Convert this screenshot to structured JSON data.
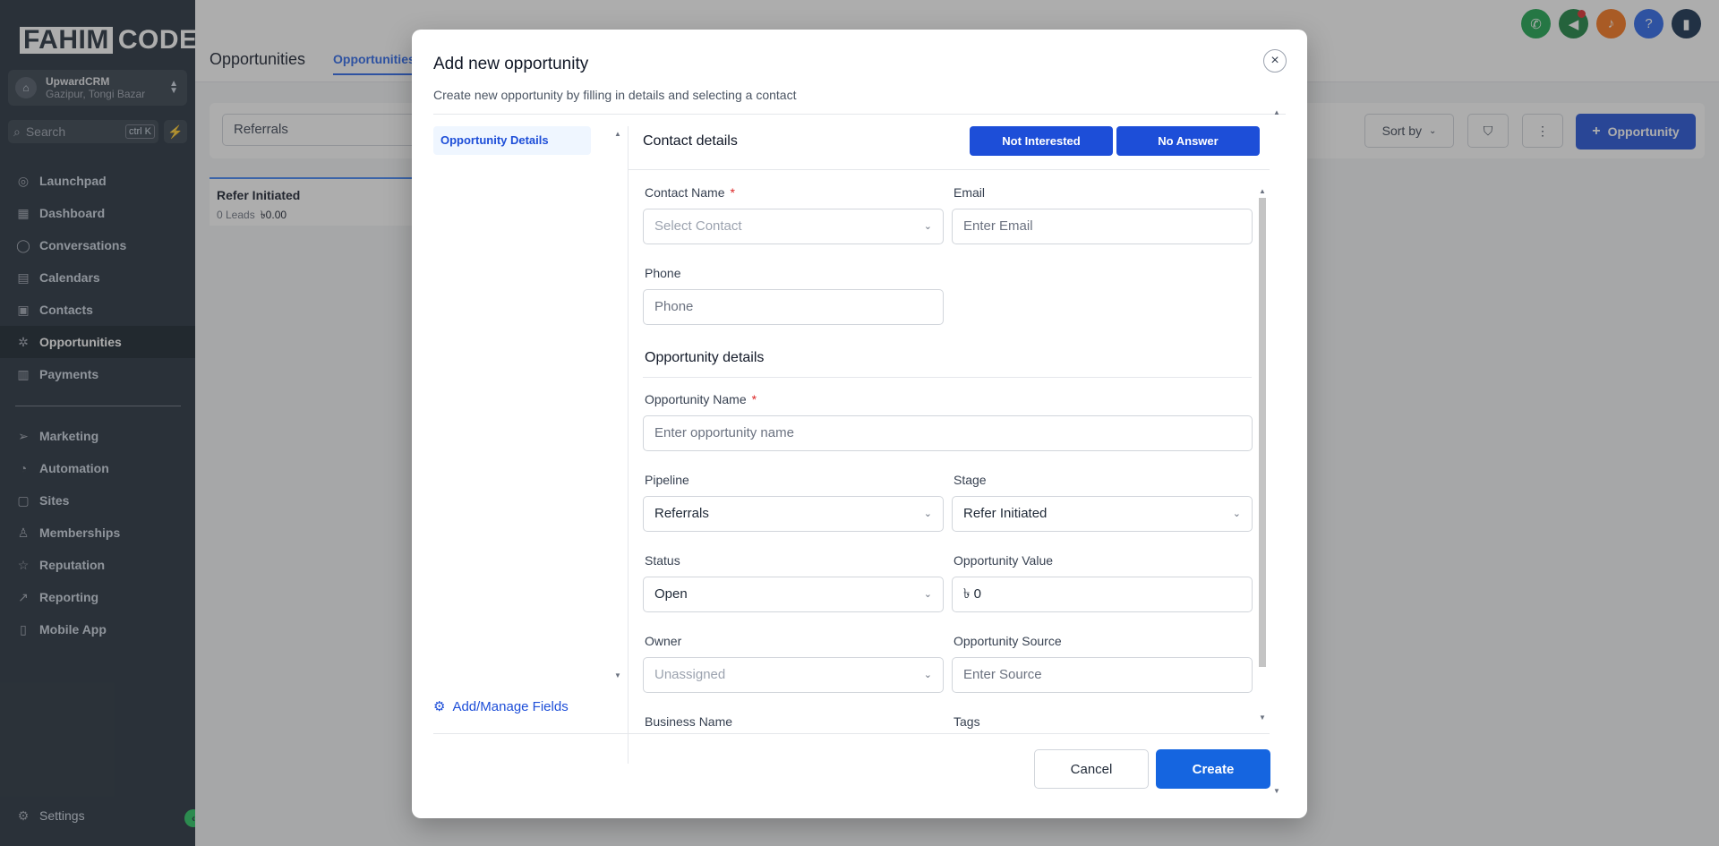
{
  "sidebar": {
    "logo_boxed": "FAHIM",
    "logo_rest": "CODE",
    "account": {
      "name": "UpwardCRM",
      "location": "Gazipur, Tongi Bazar"
    },
    "search": {
      "placeholder": "Search",
      "shortcut": "ctrl K"
    },
    "items": [
      {
        "label": "Launchpad",
        "icon": "rocket-icon"
      },
      {
        "label": "Dashboard",
        "icon": "grid-icon"
      },
      {
        "label": "Conversations",
        "icon": "chat-icon"
      },
      {
        "label": "Calendars",
        "icon": "calendar-icon"
      },
      {
        "label": "Contacts",
        "icon": "contacts-icon"
      },
      {
        "label": "Opportunities",
        "icon": "opportunities-icon"
      },
      {
        "label": "Payments",
        "icon": "payments-icon"
      }
    ],
    "items2": [
      {
        "label": "Marketing",
        "icon": "send-icon"
      },
      {
        "label": "Automation",
        "icon": "automation-icon"
      },
      {
        "label": "Sites",
        "icon": "sites-icon"
      },
      {
        "label": "Memberships",
        "icon": "memberships-icon"
      },
      {
        "label": "Reputation",
        "icon": "star-icon"
      },
      {
        "label": "Reporting",
        "icon": "chart-icon"
      },
      {
        "label": "Mobile App",
        "icon": "mobile-icon"
      }
    ],
    "settings": "Settings"
  },
  "main": {
    "title": "Opportunities",
    "tab": "Opportunities",
    "pipeline": "Referrals",
    "sort_by": "Sort by",
    "add_opportunity": "Opportunity",
    "stage": {
      "name": "Refer Initiated",
      "leads": "0 Leads",
      "value": "৳0.00"
    }
  },
  "modal": {
    "title": "Add new opportunity",
    "subtitle": "Create new opportunity by filling in details and selecting a contact",
    "side_tab": "Opportunity Details",
    "manage_fields": "Add/Manage Fields",
    "contact_details": "Contact details",
    "not_interested": "Not Interested",
    "no_answer": "No Answer",
    "contact_name_label": "Contact Name",
    "contact_name_placeholder": "Select Contact",
    "email_label": "Email",
    "email_placeholder": "Enter Email",
    "phone_label": "Phone",
    "phone_placeholder": "Phone",
    "opportunity_details": "Opportunity details",
    "opp_name_label": "Opportunity Name",
    "opp_name_placeholder": "Enter opportunity name",
    "pipeline_label": "Pipeline",
    "pipeline_value": "Referrals",
    "stage_label": "Stage",
    "stage_value": "Refer Initiated",
    "status_label": "Status",
    "status_value": "Open",
    "value_label": "Opportunity Value",
    "value_value": "৳ 0",
    "owner_label": "Owner",
    "owner_value": "Unassigned",
    "source_label": "Opportunity Source",
    "source_placeholder": "Enter Source",
    "business_label": "Business Name",
    "tags_label": "Tags",
    "cancel": "Cancel",
    "create": "Create",
    "required_mark": "*"
  },
  "colors": {
    "primary": "#1d4ed8",
    "sidebar": "#1e2a37",
    "required": "#dc2626"
  }
}
